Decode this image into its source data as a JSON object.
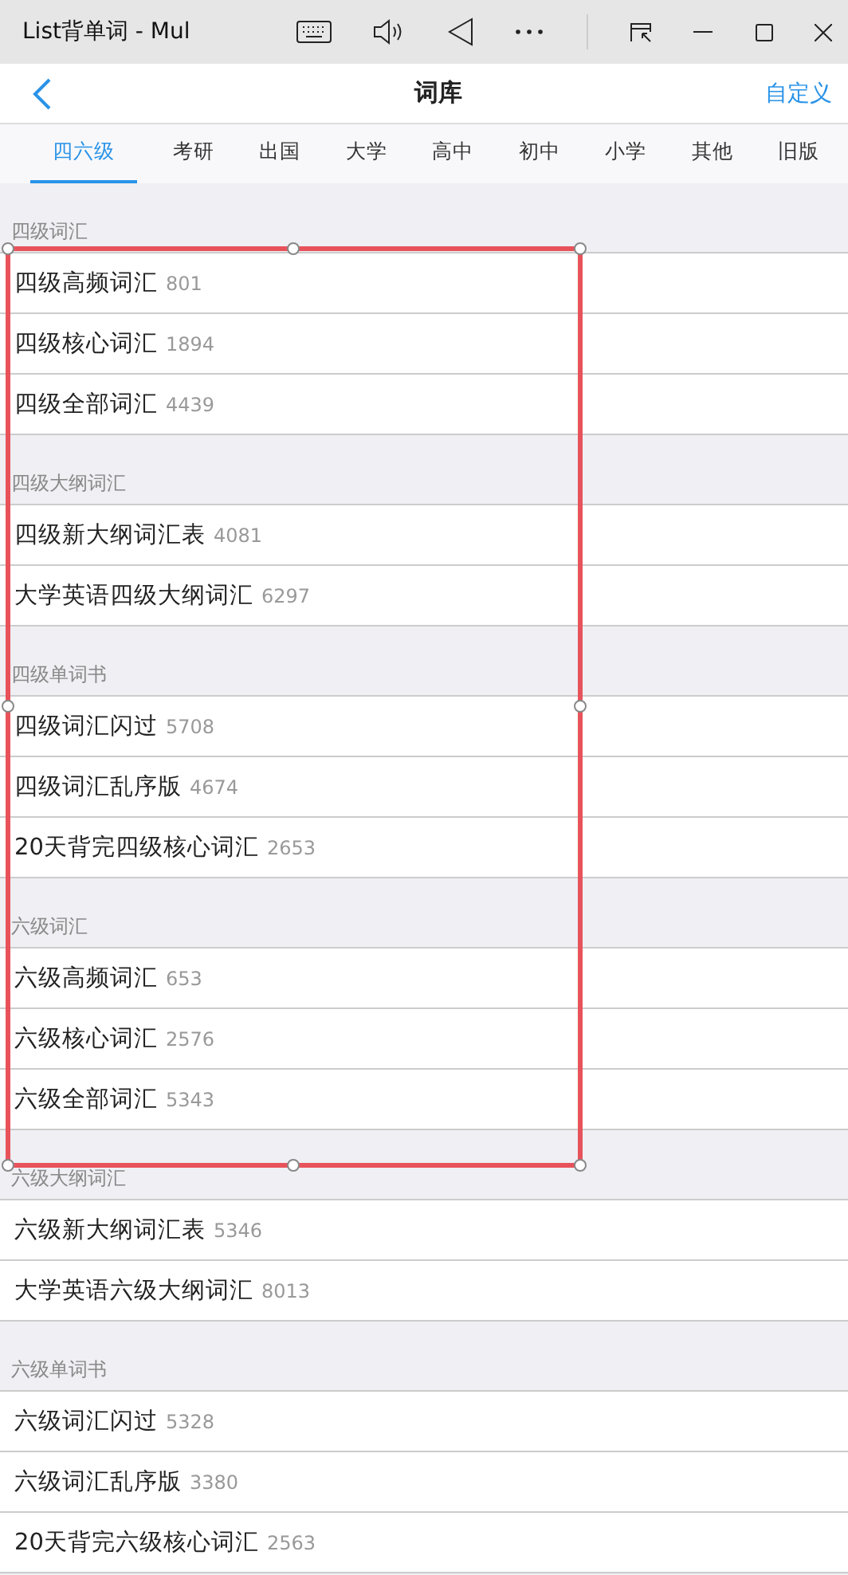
{
  "window": {
    "title": "List背单词 - Mul"
  },
  "header": {
    "title": "词库",
    "action": "自定义"
  },
  "tabs": [
    {
      "label": "四六级",
      "selected": true
    },
    {
      "label": "考研",
      "selected": false
    },
    {
      "label": "出国",
      "selected": false
    },
    {
      "label": "大学",
      "selected": false
    },
    {
      "label": "高中",
      "selected": false
    },
    {
      "label": "初中",
      "selected": false
    },
    {
      "label": "小学",
      "selected": false
    },
    {
      "label": "其他",
      "selected": false
    },
    {
      "label": "旧版",
      "selected": false
    }
  ],
  "sections": [
    {
      "title": "四级词汇",
      "items": [
        {
          "name": "四级高频词汇",
          "count": "801"
        },
        {
          "name": "四级核心词汇",
          "count": "1894"
        },
        {
          "name": "四级全部词汇",
          "count": "4439"
        }
      ]
    },
    {
      "title": "四级大纲词汇",
      "items": [
        {
          "name": "四级新大纲词汇表",
          "count": "4081"
        },
        {
          "name": "大学英语四级大纲词汇",
          "count": "6297"
        }
      ]
    },
    {
      "title": "四级单词书",
      "items": [
        {
          "name": "四级词汇闪过",
          "count": "5708"
        },
        {
          "name": "四级词汇乱序版",
          "count": "4674"
        },
        {
          "name": "20天背完四级核心词汇",
          "count": "2653"
        }
      ]
    },
    {
      "title": "六级词汇",
      "items": [
        {
          "name": "六级高频词汇",
          "count": "653"
        },
        {
          "name": "六级核心词汇",
          "count": "2576"
        },
        {
          "name": "六级全部词汇",
          "count": "5343"
        }
      ]
    },
    {
      "title": "六级大纲词汇",
      "items": [
        {
          "name": "六级新大纲词汇表",
          "count": "5346"
        },
        {
          "name": "大学英语六级大纲词汇",
          "count": "8013"
        }
      ]
    },
    {
      "title": "六级单词书",
      "items": [
        {
          "name": "六级词汇闪过",
          "count": "5328"
        },
        {
          "name": "六级词汇乱序版",
          "count": "3380"
        },
        {
          "name": "20天背完六级核心词汇",
          "count": "2563"
        }
      ]
    }
  ],
  "selection": {
    "visible": true
  }
}
